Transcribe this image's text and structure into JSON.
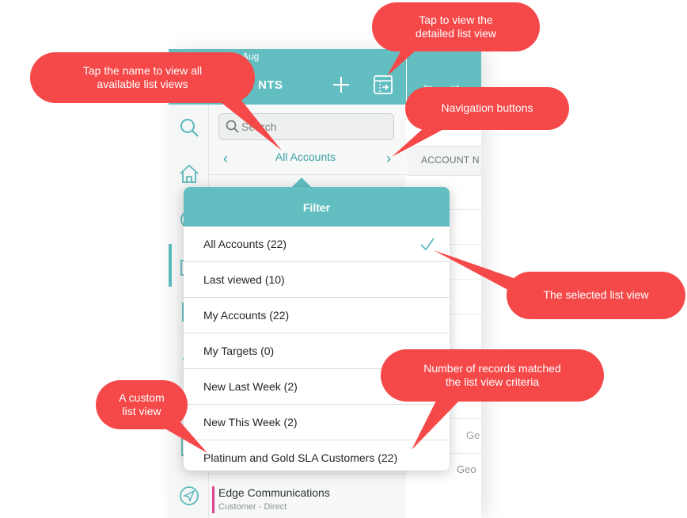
{
  "header": {
    "date_fragment": "Aug",
    "title_fragment": "NTS"
  },
  "search": {
    "placeholder": "Search"
  },
  "list_view": {
    "current": "All Accounts",
    "prev_glyph": "‹",
    "next_glyph": "›"
  },
  "detail": {
    "back_glyph": "←",
    "forward_glyph": "→",
    "column_header": "ACCOUNT N",
    "cell_1": "Ge",
    "cell_2": "Geo"
  },
  "popover": {
    "title": "Filter",
    "items": [
      {
        "label": "All Accounts (22)",
        "selected": true
      },
      {
        "label": "Last viewed (10)",
        "selected": false
      },
      {
        "label": "My Accounts (22)",
        "selected": false
      },
      {
        "label": "My Targets (0)",
        "selected": false
      },
      {
        "label": "New Last Week (2)",
        "selected": false
      },
      {
        "label": "New This Week (2)",
        "selected": false
      },
      {
        "label": "Platinum and Gold SLA Customers (22)",
        "selected": false
      }
    ]
  },
  "list_item": {
    "name": "Edge Communications",
    "subtitle": "Customer - Direct"
  },
  "callouts": {
    "detail_view": [
      "Tap to view the",
      "detailed list view"
    ],
    "name": [
      "Tap the name to view all",
      "available list views"
    ],
    "navigation": [
      "Navigation buttons"
    ],
    "selected": [
      "The selected list view"
    ],
    "records": [
      "Number of records matched",
      "the list view criteria"
    ],
    "custom": [
      "A custom",
      "list view"
    ]
  },
  "colors": {
    "accent": "#63bec1",
    "accent_text": "#3aa0a4",
    "callout": "#f54849"
  },
  "icons": {
    "rail": [
      "search-icon",
      "home-icon",
      "clock-icon",
      "calendar-icon",
      "document-icon",
      "check-icon",
      "note-icon",
      "send-icon"
    ],
    "header": [
      "plus-icon",
      "list-detail-icon"
    ]
  }
}
